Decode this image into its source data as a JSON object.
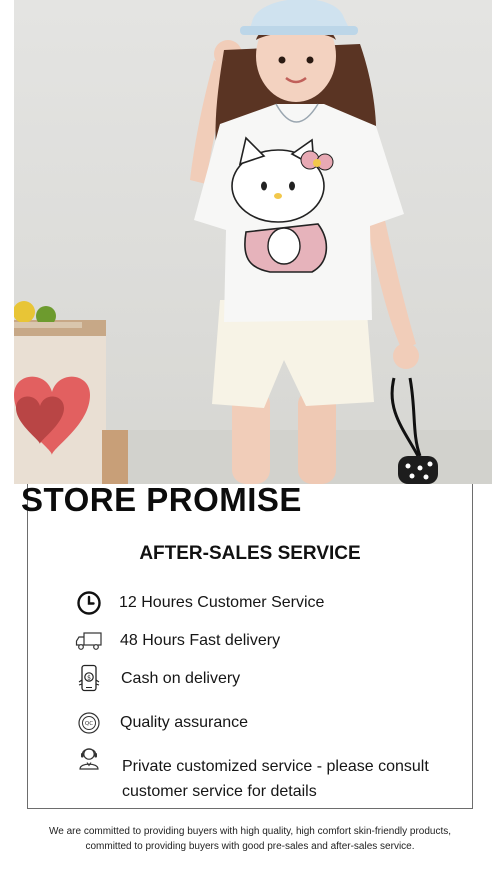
{
  "photo": {
    "alt": "Girl wearing a white cartoon cat print T-shirt with cream shorts and a cap"
  },
  "promise": {
    "title": "STORE PROMISE",
    "subtitle": "AFTER-SALES SERVICE",
    "items": [
      {
        "icon": "clock-icon",
        "label": "12 Houres Customer Service"
      },
      {
        "icon": "delivery-truck-icon",
        "label": "48 Hours Fast delivery"
      },
      {
        "icon": "cash-phone-icon",
        "label": "Cash on delivery"
      },
      {
        "icon": "quality-badge-icon",
        "label": "Quality assurance"
      },
      {
        "icon": "customer-service-agent-icon",
        "label": "Private customized service - please consult customer service for details"
      }
    ]
  },
  "footer": {
    "line1": "We are committed to providing buyers with high quality, high comfort skin-friendly products,",
    "line2": "committed to providing buyers with good pre-sales and after-sales service."
  }
}
